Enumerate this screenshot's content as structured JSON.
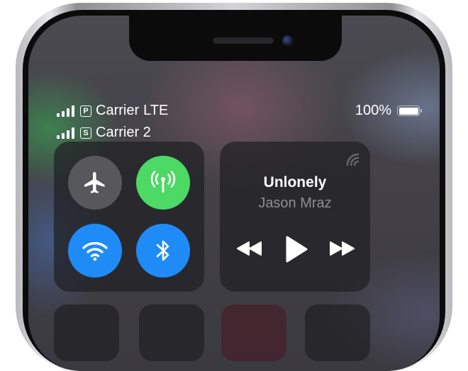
{
  "status_bar": {
    "carrier_1": {
      "sim_label": "P",
      "name": "Carrier",
      "network": "LTE"
    },
    "carrier_2": {
      "sim_label": "S",
      "name": "Carrier 2"
    },
    "battery_text": "100%",
    "battery_level": 1.0
  },
  "connectivity": {
    "airplane_mode": {
      "icon": "airplane-icon",
      "state": "off",
      "color": "#57575c"
    },
    "cellular_data": {
      "icon": "antenna-icon",
      "state": "on",
      "color": "#4cd964"
    },
    "wifi": {
      "icon": "wifi-icon",
      "state": "on",
      "color": "#1f8bf6"
    },
    "bluetooth": {
      "icon": "bluetooth-icon",
      "state": "on",
      "color": "#1f8bf6"
    }
  },
  "now_playing": {
    "title": "Unlonely",
    "artist": "Jason Mraz",
    "airplay_icon": "airplay-icon",
    "controls": [
      "previous-icon",
      "play-icon",
      "next-icon"
    ]
  }
}
